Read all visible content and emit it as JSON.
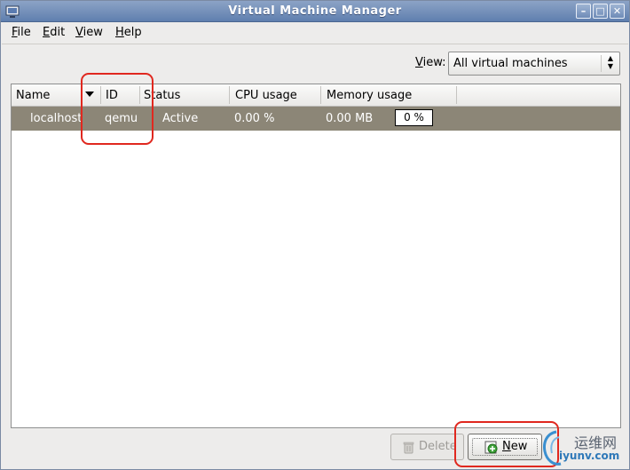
{
  "window": {
    "title": "Virtual Machine Manager"
  },
  "menu": [
    {
      "label": "File",
      "mnemonic": "F",
      "rest": "ile"
    },
    {
      "label": "Edit",
      "mnemonic": "E",
      "rest": "dit"
    },
    {
      "label": "View",
      "mnemonic": "V",
      "rest": "iew"
    },
    {
      "label": "Help",
      "mnemonic": "H",
      "rest": "elp"
    }
  ],
  "filter": {
    "label": "View:",
    "mnemonic": "V",
    "rest": "iew:",
    "selected": "All virtual machines"
  },
  "table": {
    "columns": [
      "Name",
      "ID",
      "Status",
      "CPU usage",
      "Memory usage"
    ],
    "rows": [
      {
        "name": "localhost",
        "id": "qemu",
        "status": "Active",
        "cpu": "0.00 %",
        "memory": "0.00 MB",
        "memory_bar": "0 %",
        "selected": true
      }
    ]
  },
  "buttons": {
    "delete": {
      "label": "Delete",
      "enabled": false
    },
    "new": {
      "label": "New",
      "mnemonic": "N",
      "rest": "ew"
    }
  },
  "watermark": {
    "text_cn": "运维网",
    "url": "iyunv.com"
  },
  "colors": {
    "selection": "#8c8677",
    "annotation": "#e0281f",
    "titlebar": "#6f8cb8"
  }
}
